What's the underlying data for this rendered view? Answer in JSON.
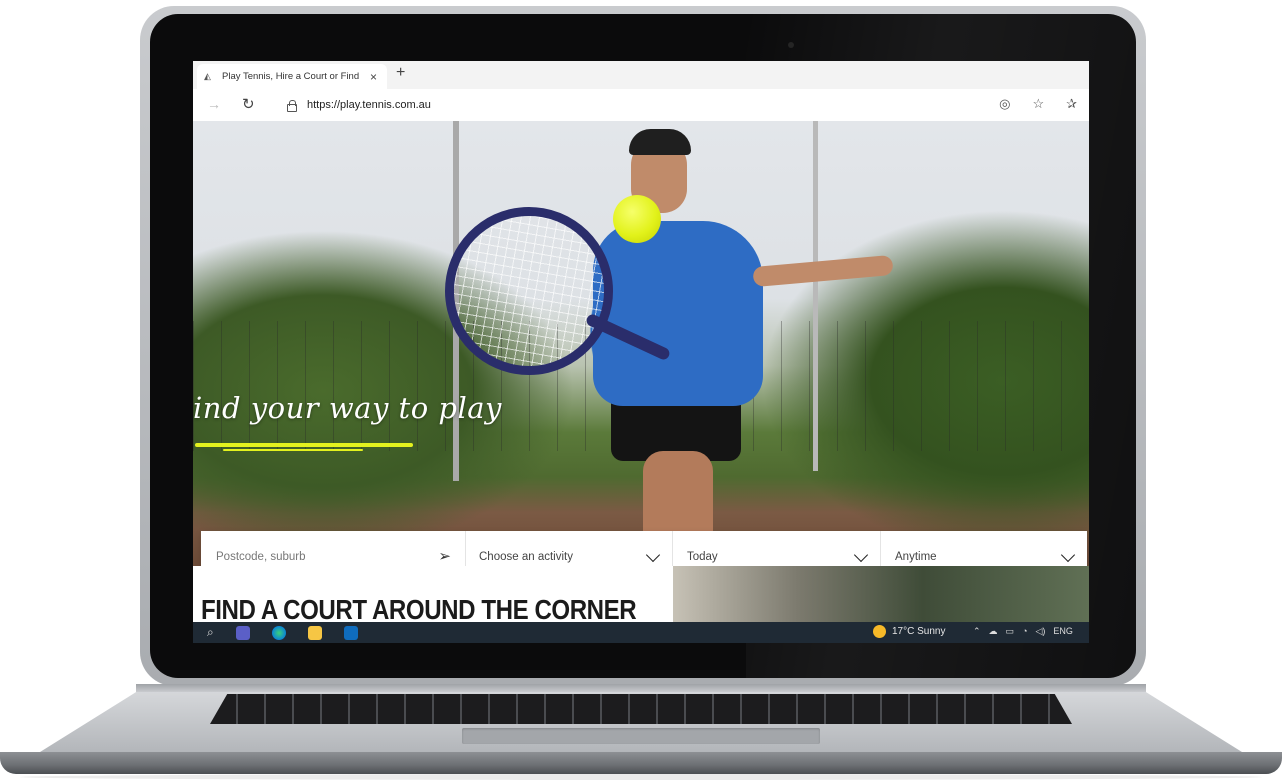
{
  "browser": {
    "tab_title": "Play Tennis, Hire a Court or Find",
    "tab_close": "×",
    "new_tab": "+",
    "url": "https://play.tennis.com.au"
  },
  "hero": {
    "tagline": "ind your way to play"
  },
  "search": {
    "location_placeholder": "Postcode, suburb",
    "activity": "Choose an activity",
    "date": "Today",
    "time": "Anytime"
  },
  "section": {
    "heading": "FIND A COURT AROUND THE CORNER"
  },
  "taskbar": {
    "weather": "17°C  Sunny",
    "language": "ENG"
  },
  "colors": {
    "accent_yellow": "#e3f21e",
    "taskbar": "#1f2a35",
    "shirt_blue": "#2e6cc4"
  },
  "icons": [
    "back-icon",
    "reload-icon",
    "lock-icon",
    "location-icon",
    "favorites-icon",
    "collections-icon",
    "location-pointer-icon",
    "chevron-down-icon",
    "search-icon",
    "teams-icon",
    "edge-icon",
    "file-explorer-icon",
    "outlook-icon",
    "sun-icon"
  ]
}
